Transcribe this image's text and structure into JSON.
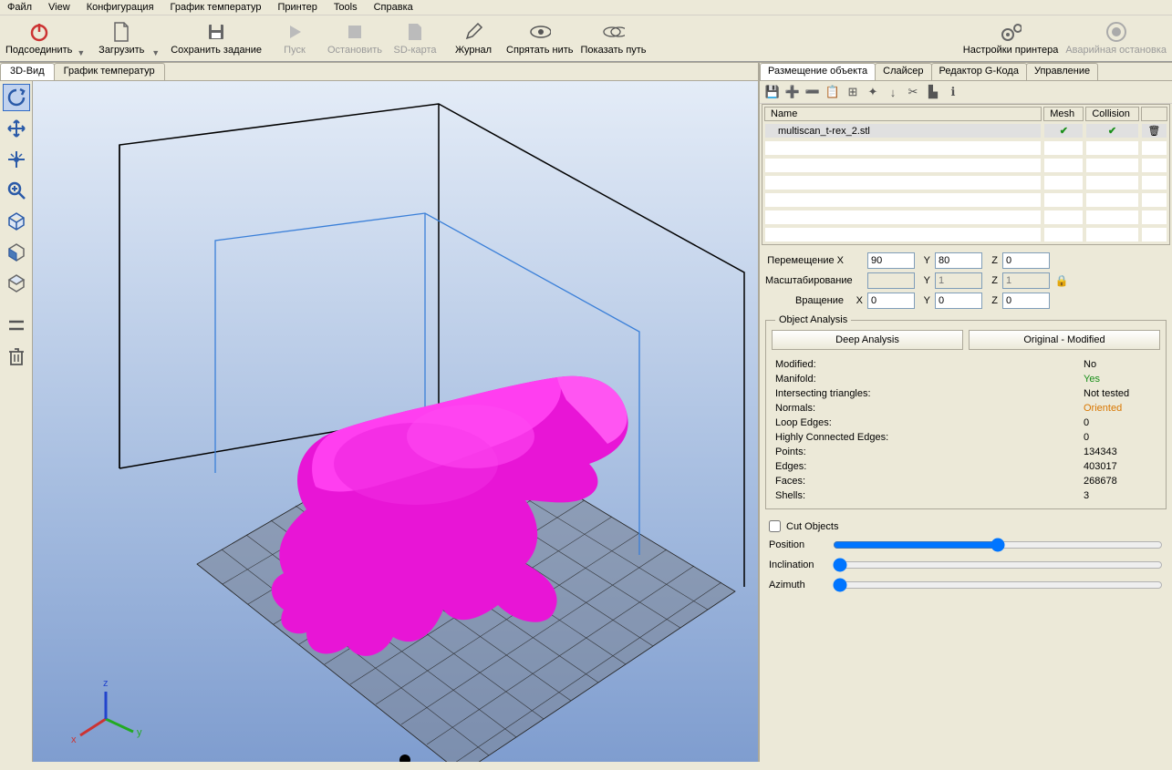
{
  "menu": {
    "file": "Файл",
    "view": "View",
    "config": "Конфигурация",
    "temp_chart": "График температур",
    "printer": "Принтер",
    "tools": "Tools",
    "help": "Справка"
  },
  "toolbar": {
    "connect": "Подсоединить",
    "load": "Загрузить",
    "save_job": "Сохранить задание",
    "start": "Пуск",
    "stop": "Остановить",
    "sdcard": "SD-карта",
    "log": "Журнал",
    "hide_filament": "Спрятать нить",
    "show_path": "Показать путь",
    "printer_settings": "Настройки принтера",
    "emergency": "Аварийная остановка"
  },
  "left_tabs": {
    "view3d": "3D-Вид",
    "temp_chart": "График температур"
  },
  "right_tabs": {
    "placement": "Размещение объекта",
    "slicer": "Слайсер",
    "gcode_editor": "Редактор G-Кода",
    "control": "Управление"
  },
  "table": {
    "h_name": "Name",
    "h_mesh": "Mesh",
    "h_collision": "Collision",
    "row_name": "multiscan_t-rex_2.stl"
  },
  "transform": {
    "move_lbl": "Перемещение X",
    "scale_lbl": "Масштабирование",
    "rotate_lbl": "Вращение",
    "x": "X",
    "y": "Y",
    "z": "Z",
    "move_x": "90",
    "move_y": "80",
    "move_z": "0",
    "scale_x": "",
    "scale_y": "1",
    "scale_z": "1",
    "rot_x": "0",
    "rot_y": "0",
    "rot_z": "0"
  },
  "analysis": {
    "title": "Object Analysis",
    "deep_btn": "Deep Analysis",
    "orig_btn": "Original - Modified",
    "modified_l": "Modified:",
    "modified_v": "No",
    "manifold_l": "Manifold:",
    "manifold_v": "Yes",
    "intersect_l": "Intersecting triangles:",
    "intersect_v": "Not tested",
    "normals_l": "Normals:",
    "normals_v": "Oriented",
    "loop_l": "Loop Edges:",
    "loop_v": "0",
    "highly_l": "Highly Connected Edges:",
    "highly_v": "0",
    "points_l": "Points:",
    "points_v": "134343",
    "edges_l": "Edges:",
    "edges_v": "403017",
    "faces_l": "Faces:",
    "faces_v": "268678",
    "shells_l": "Shells:",
    "shells_v": "3"
  },
  "cut": {
    "title": "Cut Objects",
    "position": "Position",
    "inclination": "Inclination",
    "azimuth": "Azimuth"
  }
}
